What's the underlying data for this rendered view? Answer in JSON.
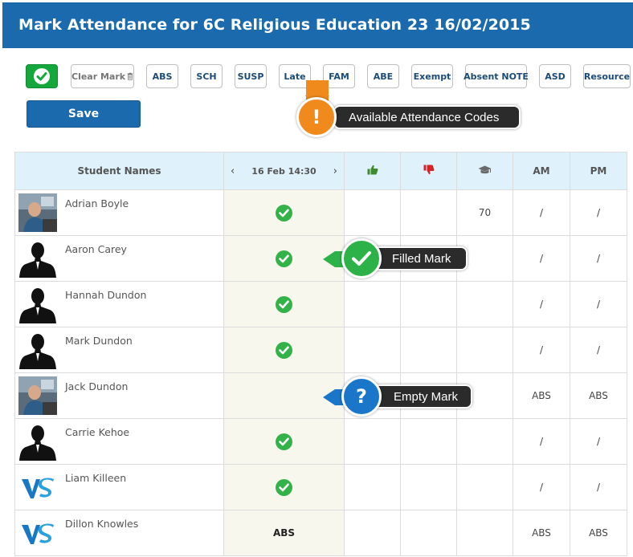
{
  "header": {
    "title": "Mark Attendance for 6C Religious Education 23 16/02/2015"
  },
  "toolbar": {
    "present_icon": "check-icon",
    "clear_label": "Clear Mark",
    "codes": [
      "ABS",
      "SCH",
      "SUSP",
      "Late",
      "FAM",
      "ABE",
      "Exempt",
      "Absent NOTE",
      "ASD",
      "Resource"
    ],
    "save_label": "Save"
  },
  "table": {
    "headers": {
      "student_names": "Student Names",
      "session": "16 Feb 14:30",
      "prev": "‹",
      "next": "›",
      "positive_icon": "thumbs-up-icon",
      "negative_icon": "thumbs-down-icon",
      "grade_icon": "graduation-cap-icon",
      "am": "AM",
      "pm": "PM"
    },
    "rows": [
      {
        "name": "Adrian Boyle",
        "avatar": "photo",
        "mark": "check",
        "score": "70",
        "am": "/",
        "pm": "/"
      },
      {
        "name": "Aaron Carey",
        "avatar": "silhouette",
        "mark": "check",
        "score": "",
        "am": "/",
        "pm": "/"
      },
      {
        "name": "Hannah Dundon",
        "avatar": "silhouette",
        "mark": "check",
        "score": "",
        "am": "/",
        "pm": "/"
      },
      {
        "name": "Mark Dundon",
        "avatar": "silhouette",
        "mark": "check",
        "score": "",
        "am": "/",
        "pm": "/"
      },
      {
        "name": "Jack Dundon",
        "avatar": "photo",
        "mark": "empty",
        "score": "",
        "am": "ABS",
        "pm": "ABS"
      },
      {
        "name": "Carrie Kehoe",
        "avatar": "silhouette",
        "mark": "check",
        "score": "",
        "am": "/",
        "pm": "/"
      },
      {
        "name": "Liam Killeen",
        "avatar": "vs-logo",
        "mark": "check",
        "score": "",
        "am": "/",
        "pm": "/"
      },
      {
        "name": "Dillon Knowles",
        "avatar": "vs-logo",
        "mark": "ABS",
        "score": "",
        "am": "ABS",
        "pm": "ABS"
      }
    ]
  },
  "callouts": {
    "codes": "Available Attendance Codes",
    "filled": "Filled Mark",
    "empty": "Empty Mark"
  },
  "colors": {
    "header_bg": "#1a6aad",
    "present_green": "#34b24a",
    "callout_orange": "#f08a1c",
    "callout_green": "#2db24a",
    "callout_blue": "#1a76c9"
  }
}
